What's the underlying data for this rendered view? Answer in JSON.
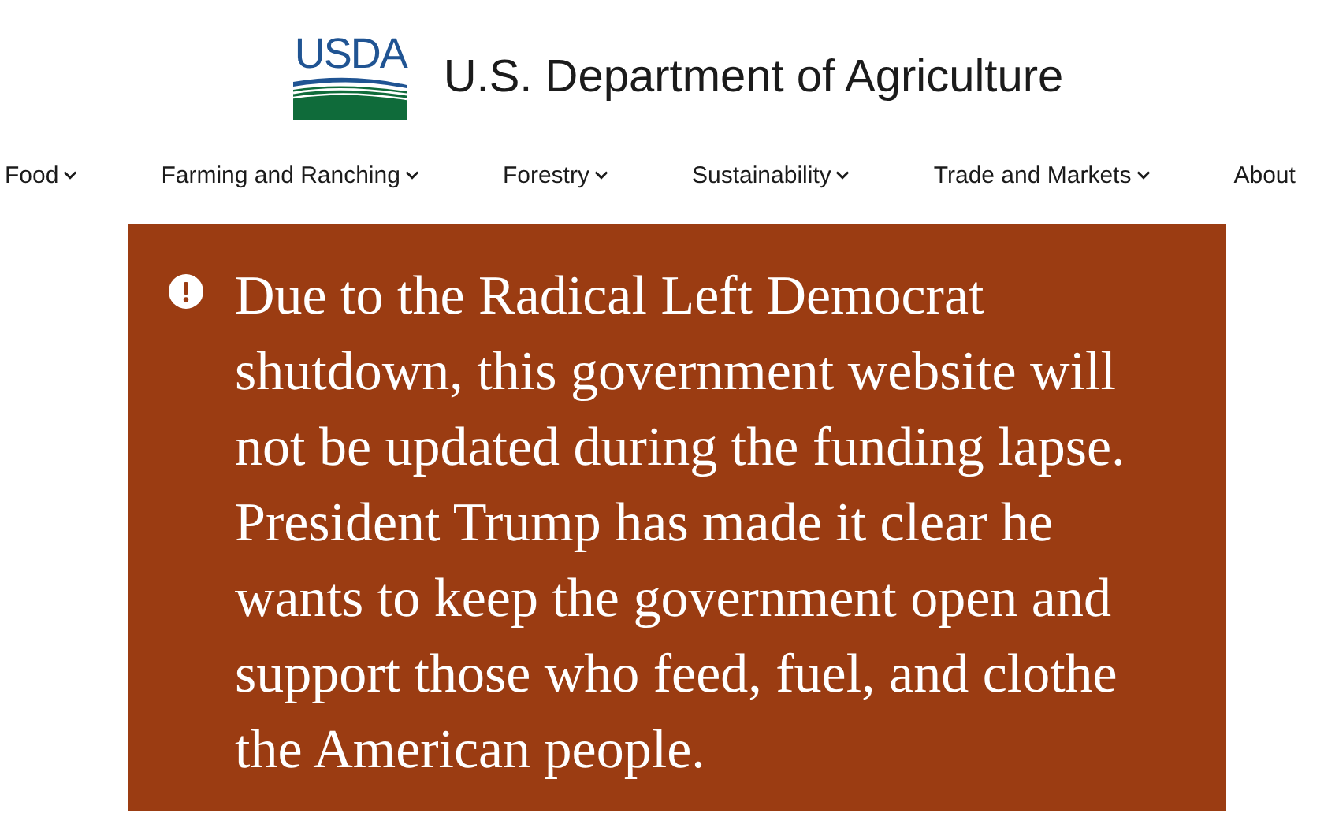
{
  "header": {
    "logo_text": "USDA",
    "title": "U.S. Department of Agriculture"
  },
  "nav": [
    {
      "label": "Food",
      "dropdown": true
    },
    {
      "label": "Farming and Ranching",
      "dropdown": true
    },
    {
      "label": "Forestry",
      "dropdown": true
    },
    {
      "label": "Sustainability",
      "dropdown": true
    },
    {
      "label": "Trade and Markets",
      "dropdown": true
    },
    {
      "label": "About",
      "dropdown": false
    }
  ],
  "alert": {
    "kind": "warning",
    "message": "Due to the Radical Left Democrat shutdown, this government website will not be updated during the funding lapse. President Trump has made it clear he wants to keep the government open and support those who feed, fuel, and clothe the American people."
  }
}
